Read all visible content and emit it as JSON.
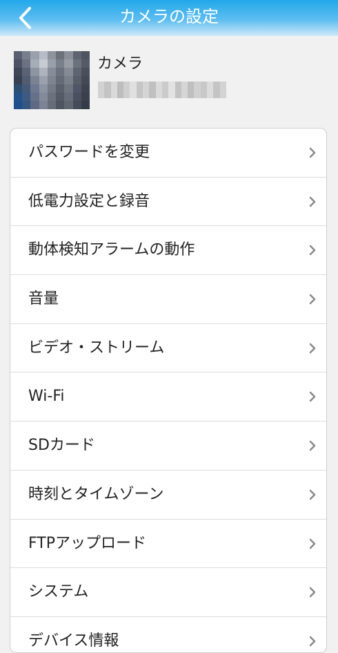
{
  "header": {
    "title": "カメラの設定",
    "back_icon": "chevron-left-icon",
    "colors": {
      "gradient_top": "#22a8ea",
      "gradient_bottom": "#cde9f9"
    }
  },
  "camera": {
    "name": "カメラ"
  },
  "settings": {
    "items": [
      {
        "label": "パスワードを変更",
        "icon": "chevron-right-icon"
      },
      {
        "label": "低電力設定と録音",
        "icon": "chevron-right-icon"
      },
      {
        "label": "動体検知アラームの動作",
        "icon": "chevron-right-icon"
      },
      {
        "label": "音量",
        "icon": "chevron-right-icon"
      },
      {
        "label": "ビデオ・ストリーム",
        "icon": "chevron-right-icon"
      },
      {
        "label": "Wi-Fi",
        "icon": "chevron-right-icon"
      },
      {
        "label": "SDカード",
        "icon": "chevron-right-icon"
      },
      {
        "label": "時刻とタイムゾーン",
        "icon": "chevron-right-icon"
      },
      {
        "label": "FTPアップロード",
        "icon": "chevron-right-icon"
      },
      {
        "label": "システム",
        "icon": "chevron-right-icon"
      },
      {
        "label": "デバイス情報",
        "icon": "chevron-right-icon"
      }
    ]
  }
}
